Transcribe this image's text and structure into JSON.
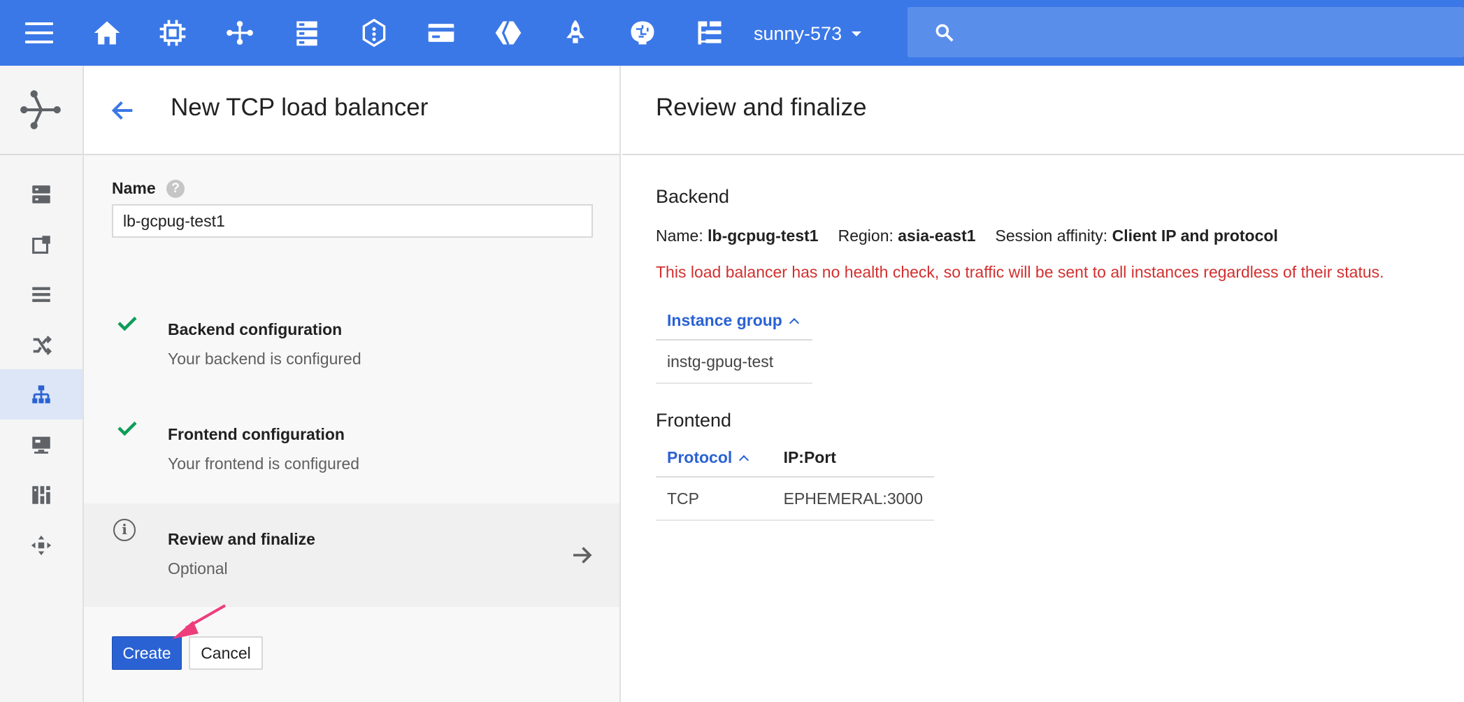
{
  "topbar": {
    "project": "sunny-573",
    "search_placeholder": "",
    "icons": [
      "menu-icon",
      "home-icon",
      "compute-icon",
      "network-icon",
      "storage-icon",
      "debug-icon",
      "billing-icon",
      "products-icon",
      "deploy-icon",
      "ml-icon",
      "logs-icon"
    ]
  },
  "rail": {
    "brand_icon": "network-services-icon",
    "items": [
      {
        "icon": "instances-icon",
        "active": false
      },
      {
        "icon": "templates-icon",
        "active": false
      },
      {
        "icon": "firewall-icon",
        "active": false
      },
      {
        "icon": "routes-icon",
        "active": false
      },
      {
        "icon": "load-balancing-icon",
        "active": true
      },
      {
        "icon": "vm-icon",
        "active": false
      },
      {
        "icon": "dashboard-icon",
        "active": false
      },
      {
        "icon": "move-icon",
        "active": false
      }
    ]
  },
  "left": {
    "title": "New TCP load balancer",
    "name_label": "Name",
    "name_value": "lb-gcpug-test1",
    "steps": [
      {
        "title": "Backend configuration",
        "subtitle": "Your backend is configured",
        "state": "done"
      },
      {
        "title": "Frontend configuration",
        "subtitle": "Your frontend is configured",
        "state": "done"
      },
      {
        "title": "Review and finalize",
        "subtitle": "Optional",
        "state": "current"
      }
    ],
    "create_label": "Create",
    "cancel_label": "Cancel"
  },
  "right": {
    "title": "Review and finalize",
    "backend": {
      "heading": "Backend",
      "name_label": "Name:",
      "name_value": "lb-gcpug-test1",
      "region_label": "Region:",
      "region_value": "asia-east1",
      "affinity_label": "Session affinity:",
      "affinity_value": "Client IP and protocol",
      "warning": "This load balancer has no health check, so traffic will be sent to all instances regardless of their status.",
      "table": {
        "header": "Instance group",
        "rows": [
          "instg-gpug-test"
        ]
      }
    },
    "frontend": {
      "heading": "Frontend",
      "table": {
        "headers": [
          "Protocol",
          "IP:Port"
        ],
        "rows": [
          [
            "TCP",
            "EPHEMERAL:3000"
          ]
        ]
      }
    }
  },
  "colors": {
    "topbar": "#3b78e7",
    "primary_button": "#2a62d3",
    "warning": "#d32f2f",
    "check": "#0f9d58",
    "annotation_arrow": "#ee3d7b"
  }
}
